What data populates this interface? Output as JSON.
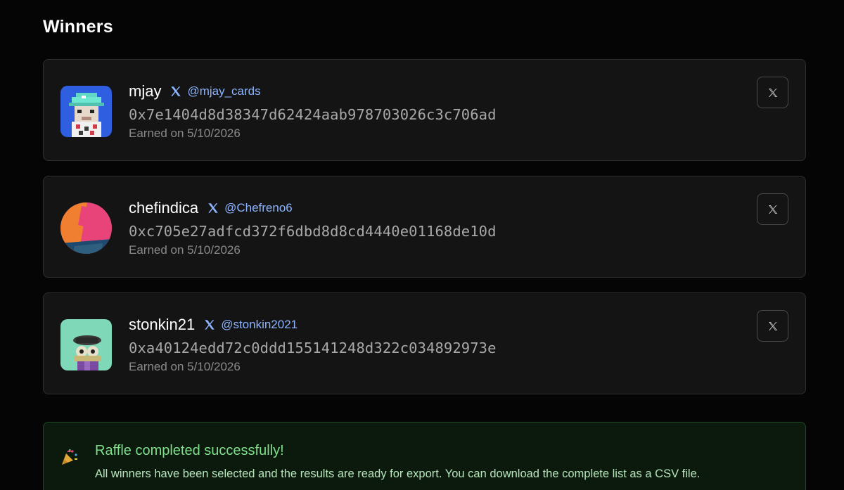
{
  "section": {
    "title": "Winners"
  },
  "winners": [
    {
      "username": "mjay",
      "x_handle": "@mjay_cards",
      "address": "0x7e1404d8d38347d62424aab978703026c3c706ad",
      "earned": "Earned on 5/10/2026",
      "avatar": "pixel-art-avatar"
    },
    {
      "username": "chefindica",
      "x_handle": "@Chefreno6",
      "address": "0xc705e27adfcd372f6dbd8d8cd4440e01168de10d",
      "earned": "Earned on 5/10/2026",
      "avatar": "abstract-shapes-avatar"
    },
    {
      "username": "stonkin21",
      "x_handle": "@stonkin2021",
      "address": "0xa40124edd72c0ddd155141248d322c034892973e",
      "earned": "Earned on 5/10/2026",
      "avatar": "cartoon-character-avatar"
    }
  ],
  "success": {
    "icon": "party-popper-icon",
    "title": "Raffle completed successfully!",
    "message": "All winners have been selected and the results are ready for export. You can download the complete list as a CSV file."
  },
  "colors": {
    "background": "#050505",
    "card": "#141414",
    "link": "#8cb4ff",
    "success": "#7ee08a"
  }
}
